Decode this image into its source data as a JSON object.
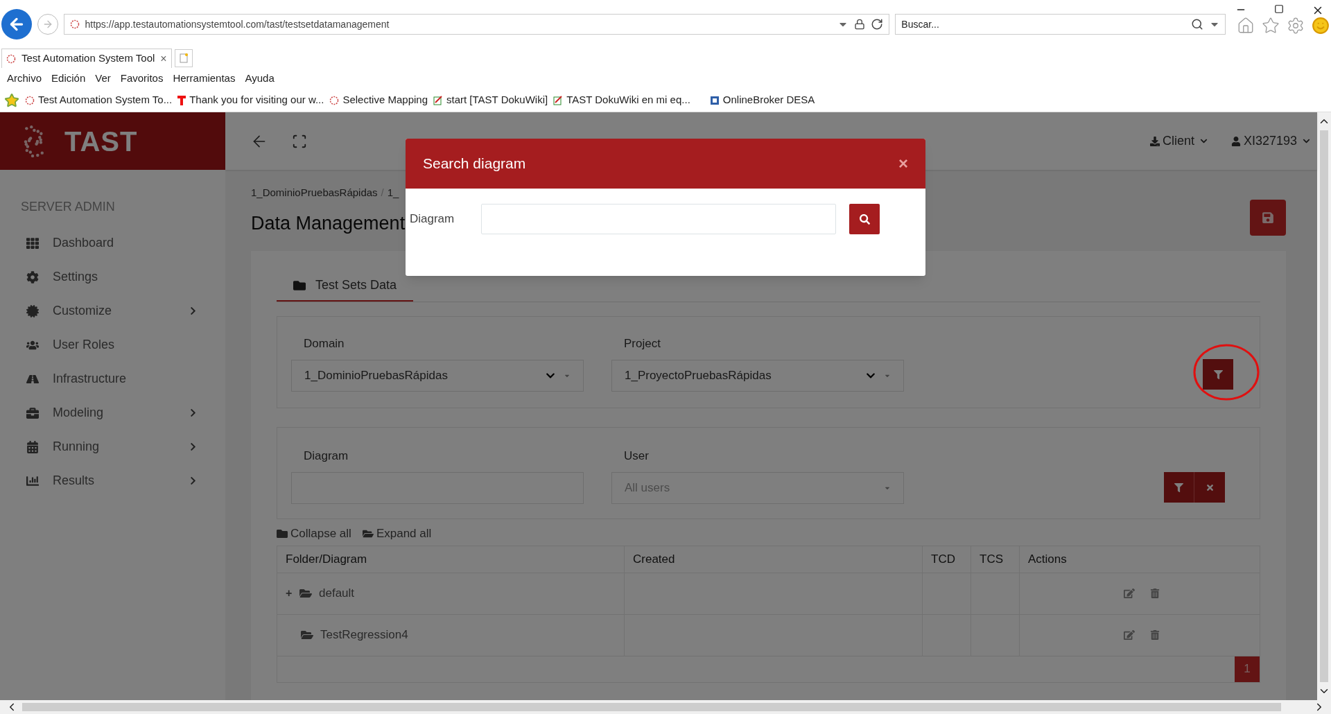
{
  "browser": {
    "url": "https://app.testautomationsystemtool.com/tast/testsetdatamanagement",
    "search_placeholder": "Buscar...",
    "tabs": [
      {
        "title": "Test Automation System Tool",
        "close": "×",
        "selected": true
      }
    ],
    "menu": [
      "Archivo",
      "Edición",
      "Ver",
      "Favoritos",
      "Herramientas",
      "Ayuda"
    ],
    "favorites": [
      "Test Automation System To...",
      "Thank you for visiting our w...",
      "Selective Mapping",
      "start [TAST DokuWiki]",
      "TAST DokuWiki en mi eq...",
      "OnlineBroker DESA"
    ]
  },
  "sidebar": {
    "logo": "TAST",
    "section": "SERVER ADMIN",
    "items": [
      {
        "label": "Dashboard",
        "has_submenu": false
      },
      {
        "label": "Settings",
        "has_submenu": false
      },
      {
        "label": "Customize",
        "has_submenu": true
      },
      {
        "label": "User Roles",
        "has_submenu": false
      },
      {
        "label": "Infrastructure",
        "has_submenu": false
      },
      {
        "label": "Modeling",
        "has_submenu": true
      },
      {
        "label": "Running",
        "has_submenu": true
      },
      {
        "label": "Results",
        "has_submenu": true
      }
    ]
  },
  "header": {
    "client": "Client",
    "user": "XI327193"
  },
  "breadcrumb": {
    "items": [
      "1_DominioPruebasRápidas",
      "1_"
    ],
    "separator": "/"
  },
  "page_title": "Data Management",
  "tabs": [
    {
      "label": "Test Sets Data",
      "selected": true
    }
  ],
  "filters": {
    "domain": {
      "label": "Domain",
      "value": "1_DominioPruebasRápidas"
    },
    "project": {
      "label": "Project",
      "value": "1_ProyectoPruebasRápidas"
    }
  },
  "search_filters": {
    "diagram": {
      "label": "Diagram"
    },
    "user": {
      "label": "User",
      "placeholder": "All users"
    }
  },
  "tree_actions": [
    "Collapse all",
    "Expand all"
  ],
  "table": {
    "columns": [
      "Folder/Diagram",
      "Created",
      "TCD",
      "TCS",
      "Actions"
    ],
    "rows": [
      {
        "toggle": "+",
        "name": "default"
      },
      {
        "name": "TestRegression4"
      }
    ]
  },
  "pagination": [
    {
      "label": "1",
      "selected": true
    }
  ],
  "modal": {
    "title": "Search diagram",
    "close": "×",
    "field_label": "Diagram"
  }
}
